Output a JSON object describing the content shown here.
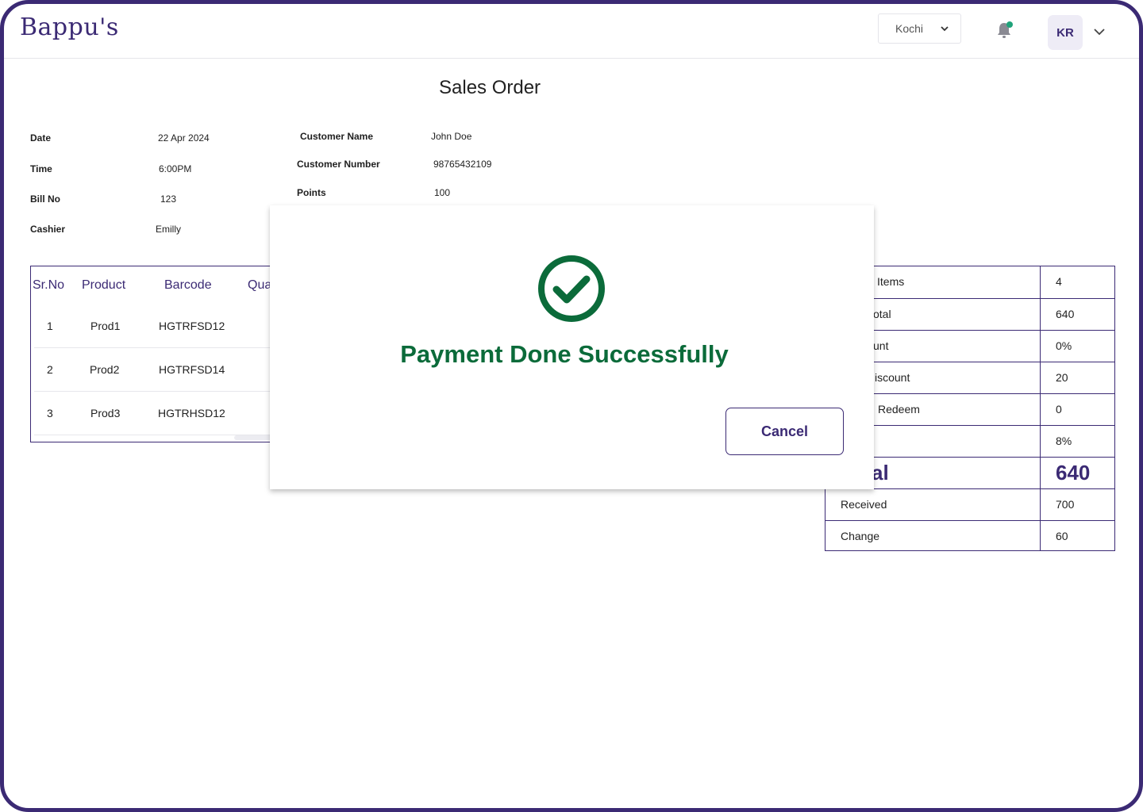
{
  "app": {
    "brand": "Bappu's"
  },
  "header": {
    "location": "Kochi",
    "avatar_initials": "KR"
  },
  "page": {
    "title": "Sales Order"
  },
  "order_info": {
    "date_label": "Date",
    "date_value": "22 Apr 2024",
    "time_label": "Time",
    "time_value": "6:00PM",
    "bill_label": "Bill No",
    "bill_value": "123",
    "cashier_label": "Cashier",
    "cashier_value": "Emilly",
    "customer_name_label": "Customer Name",
    "customer_name_value": "John Doe",
    "customer_number_label": "Customer Number",
    "customer_number_value": "98765432109",
    "points_label": "Points",
    "points_value": "100"
  },
  "product_table": {
    "columns": [
      "Sr.No",
      "Product",
      "Barcode",
      "Qua"
    ],
    "rows": [
      {
        "sr": "1",
        "product": "Prod1",
        "barcode": "HGTRFSD12"
      },
      {
        "sr": "2",
        "product": "Prod2",
        "barcode": "HGTRFSD14"
      },
      {
        "sr": "3",
        "product": "Prod3",
        "barcode": "HGTRHSD12"
      }
    ]
  },
  "summary": [
    {
      "label": "Items",
      "value": "4"
    },
    {
      "label": "otal",
      "value": "640"
    },
    {
      "label": "unt",
      "value": "0%"
    },
    {
      "label": "iscount",
      "value": "20"
    },
    {
      "label": "Redeem",
      "value": "0"
    },
    {
      "label": "",
      "value": "8%"
    },
    {
      "label": "al",
      "value": "640"
    },
    {
      "label": "Received",
      "value": "700"
    },
    {
      "label": "Change",
      "value": "60"
    }
  ],
  "modal": {
    "message": "Payment Done Successfully",
    "cancel_label": "Cancel"
  },
  "colors": {
    "brand": "#3b2a74",
    "success": "#0b6b3a",
    "notification_dot": "#1fa37a"
  }
}
